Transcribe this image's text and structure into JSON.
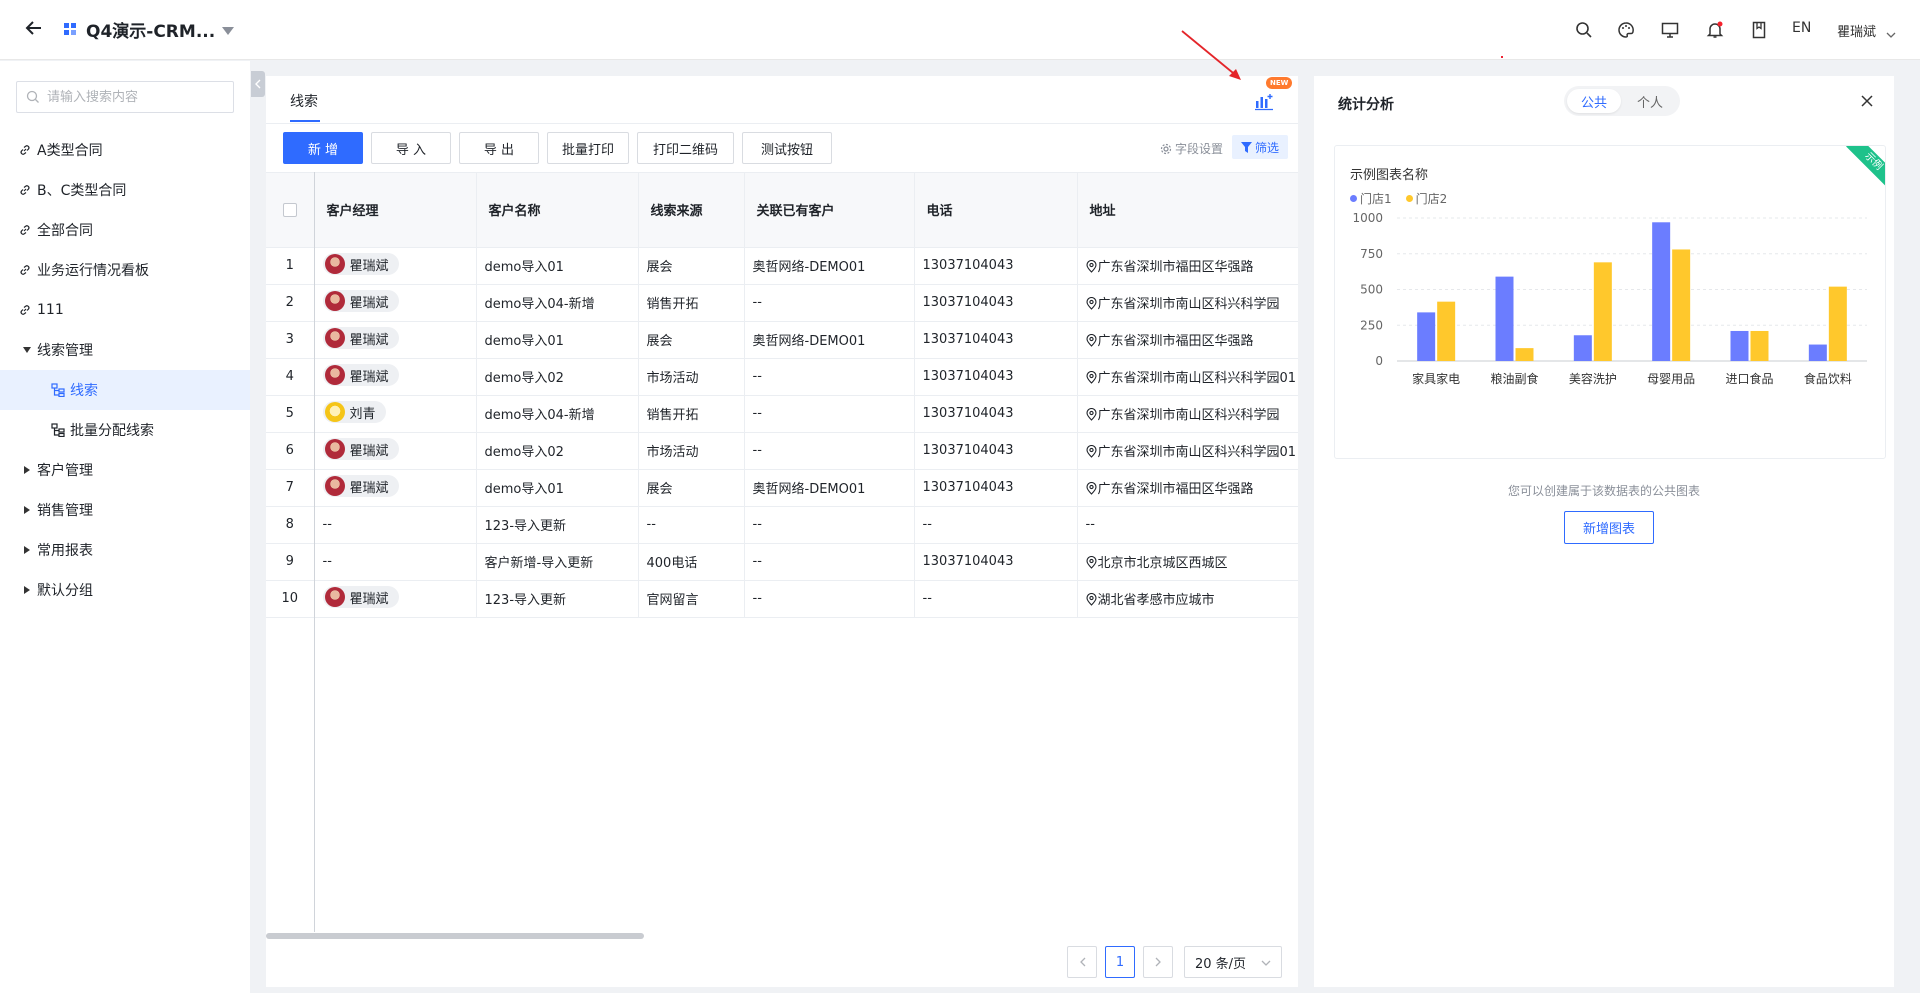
{
  "app": {
    "title": "Q4演示-CRM...",
    "lang": "EN",
    "user": "瞿瑞斌"
  },
  "sidebar": {
    "search_placeholder": "请输入搜索内容",
    "items": [
      {
        "label": "A类型合同",
        "icon": "link-icon"
      },
      {
        "label": "B、C类型合同",
        "icon": "link-icon"
      },
      {
        "label": "全部合同",
        "icon": "link-icon"
      },
      {
        "label": "业务运行情况看板",
        "icon": "link-icon"
      },
      {
        "label": "111",
        "icon": "link-icon"
      },
      {
        "label": "线索管理",
        "icon": "caret-down-icon"
      },
      {
        "label": "线索",
        "icon": "tree-icon"
      },
      {
        "label": "批量分配线索",
        "icon": "tree-icon"
      },
      {
        "label": "客户管理",
        "icon": "caret-right-icon"
      },
      {
        "label": "销售管理",
        "icon": "caret-right-icon"
      },
      {
        "label": "常用报表",
        "icon": "caret-right-icon"
      },
      {
        "label": "默认分组",
        "icon": "caret-right-icon"
      }
    ]
  },
  "main": {
    "tab": "线索",
    "new_badge": "NEW",
    "toolbar": {
      "add": "新 增",
      "import": "导 入",
      "export": "导 出",
      "batch_print": "批量打印",
      "print_qr": "打印二维码",
      "test": "测试按钮",
      "field_settings": "字段设置",
      "filter": "筛选"
    },
    "columns": [
      "客户经理",
      "客户名称",
      "线索来源",
      "关联已有客户",
      "电话",
      "地址"
    ],
    "rows": [
      {
        "idx": "1",
        "owner": "瞿瑞斌",
        "avatar": "a1",
        "name": "demo导入01",
        "source": "展会",
        "related": "奥哲网络-DEMO01",
        "phone": "13037104043",
        "address": "广东省深圳市福田区华强路"
      },
      {
        "idx": "2",
        "owner": "瞿瑞斌",
        "avatar": "a1",
        "name": "demo导入04-新增",
        "source": "销售开拓",
        "related": "--",
        "phone": "13037104043",
        "address": "广东省深圳市南山区科兴科学园"
      },
      {
        "idx": "3",
        "owner": "瞿瑞斌",
        "avatar": "a1",
        "name": "demo导入01",
        "source": "展会",
        "related": "奥哲网络-DEMO01",
        "phone": "13037104043",
        "address": "广东省深圳市福田区华强路"
      },
      {
        "idx": "4",
        "owner": "瞿瑞斌",
        "avatar": "a1",
        "name": "demo导入02",
        "source": "市场活动",
        "related": "--",
        "phone": "13037104043",
        "address": "广东省深圳市南山区科兴科学园01"
      },
      {
        "idx": "5",
        "owner": "刘青",
        "avatar": "a2",
        "name": "demo导入04-新增",
        "source": "销售开拓",
        "related": "--",
        "phone": "13037104043",
        "address": "广东省深圳市南山区科兴科学园"
      },
      {
        "idx": "6",
        "owner": "瞿瑞斌",
        "avatar": "a1",
        "name": "demo导入02",
        "source": "市场活动",
        "related": "--",
        "phone": "13037104043",
        "address": "广东省深圳市南山区科兴科学园01"
      },
      {
        "idx": "7",
        "owner": "瞿瑞斌",
        "avatar": "a1",
        "name": "demo导入01",
        "source": "展会",
        "related": "奥哲网络-DEMO01",
        "phone": "13037104043",
        "address": "广东省深圳市福田区华强路"
      },
      {
        "idx": "8",
        "owner": "--",
        "avatar": "",
        "name": "123-导入更新",
        "source": "--",
        "related": "--",
        "phone": "--",
        "address": "--"
      },
      {
        "idx": "9",
        "owner": "--",
        "avatar": "",
        "name": "客户新增-导入更新",
        "source": "400电话",
        "related": "--",
        "phone": "13037104043",
        "address": "北京市北京城区西城区"
      },
      {
        "idx": "10",
        "owner": "瞿瑞斌",
        "avatar": "a1",
        "name": "123-导入更新",
        "source": "官网留言",
        "related": "--",
        "phone": "--",
        "address": "湖北省孝感市应城市"
      }
    ],
    "pagination": {
      "current": "1",
      "page_size": "20 条/页"
    }
  },
  "panel": {
    "title": "统计分析",
    "seg_public": "公共",
    "seg_personal": "个人",
    "ribbon": "示例",
    "hint": "您可以创建属于该数据表的公共图表",
    "add_chart": "新增图表"
  },
  "colors": {
    "accent": "#2f6bff",
    "series1": "#6b7dff",
    "series2": "#ffc82c",
    "ribbon": "#1ec28b"
  },
  "chart_data": {
    "type": "bar",
    "title": "示例图表名称",
    "categories": [
      "家具家电",
      "粮油副食",
      "美容洗护",
      "母婴用品",
      "进口食品",
      "食品饮料"
    ],
    "series": [
      {
        "name": "门店1",
        "values": [
          340,
          590,
          180,
          970,
          210,
          115
        ]
      },
      {
        "name": "门店2",
        "values": [
          415,
          90,
          690,
          780,
          210,
          520
        ]
      }
    ],
    "ylim": [
      0,
      1000
    ],
    "yticks": [
      0,
      250,
      500,
      750,
      1000
    ],
    "grid": true,
    "legend": "top-left"
  }
}
